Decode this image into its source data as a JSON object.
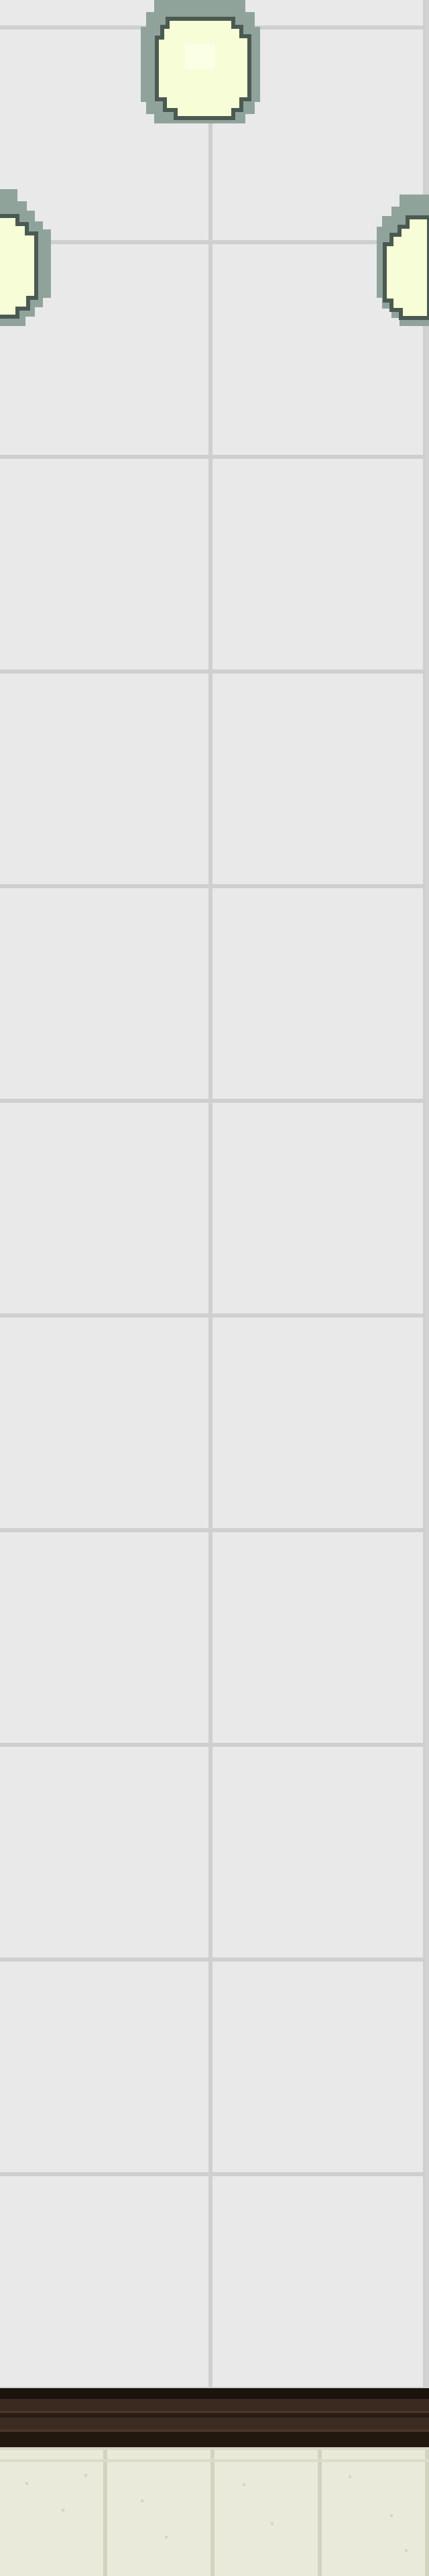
{
  "scene": {
    "type": "pixel-art room wall",
    "wall_color": "#e9e9e9",
    "grid_line_color": "#cfcfcf",
    "lamp_glass_color": "#f7fdd6",
    "lamp_cap_color": "#8fa39b",
    "ledge_color": "#2a1d14",
    "floor_color": "#eaeadb"
  },
  "lamps": [
    {
      "name": "ceiling-lamp-center"
    },
    {
      "name": "ceiling-lamp-left"
    },
    {
      "name": "ceiling-lamp-right"
    }
  ]
}
